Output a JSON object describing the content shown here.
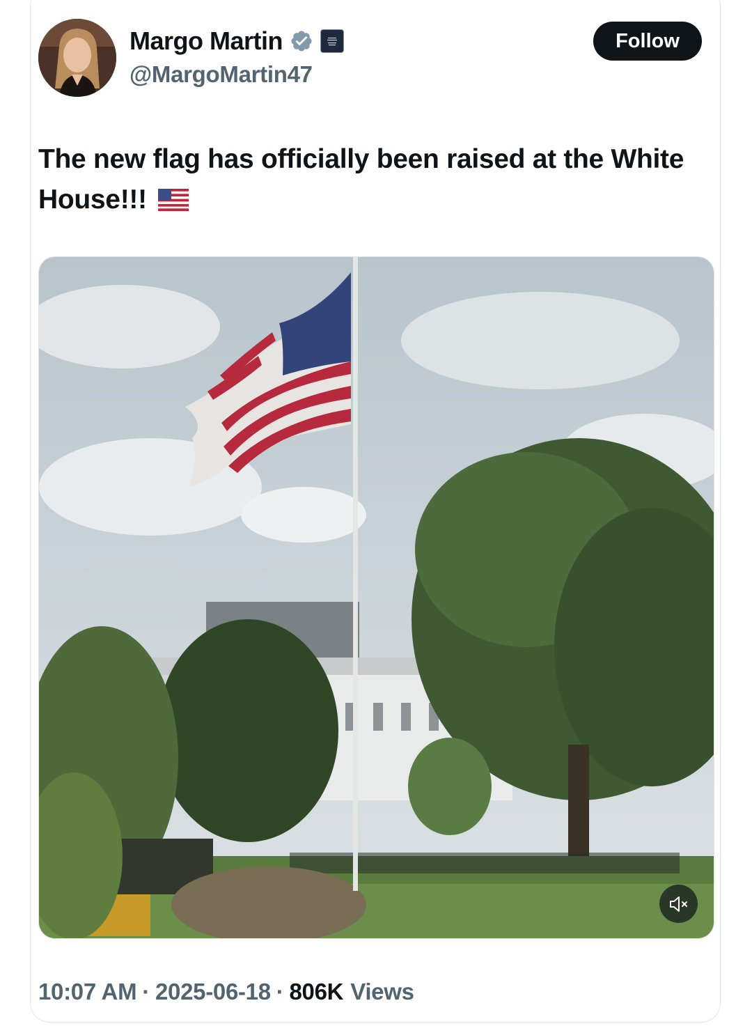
{
  "author": {
    "name": "Margo Martin",
    "handle": "@MargoMartin47",
    "verified": true,
    "affiliation_badge": "white-house-badge-icon"
  },
  "actions": {
    "follow_label": "Follow"
  },
  "tweet": {
    "text": "The new flag has officially been raised at the White House!!!",
    "emoji": "us-flag-emoji"
  },
  "media": {
    "type": "video",
    "muted": true,
    "mute_icon": "speaker-muted-icon"
  },
  "meta": {
    "time": "10:07 AM",
    "date": "2025-06-18",
    "views_count": "806K",
    "views_label": "Views",
    "separator": "·"
  },
  "colors": {
    "text_primary": "#0f1419",
    "text_secondary": "#536471",
    "verified_badge": "#829aab",
    "follow_bg": "#0f1419"
  }
}
